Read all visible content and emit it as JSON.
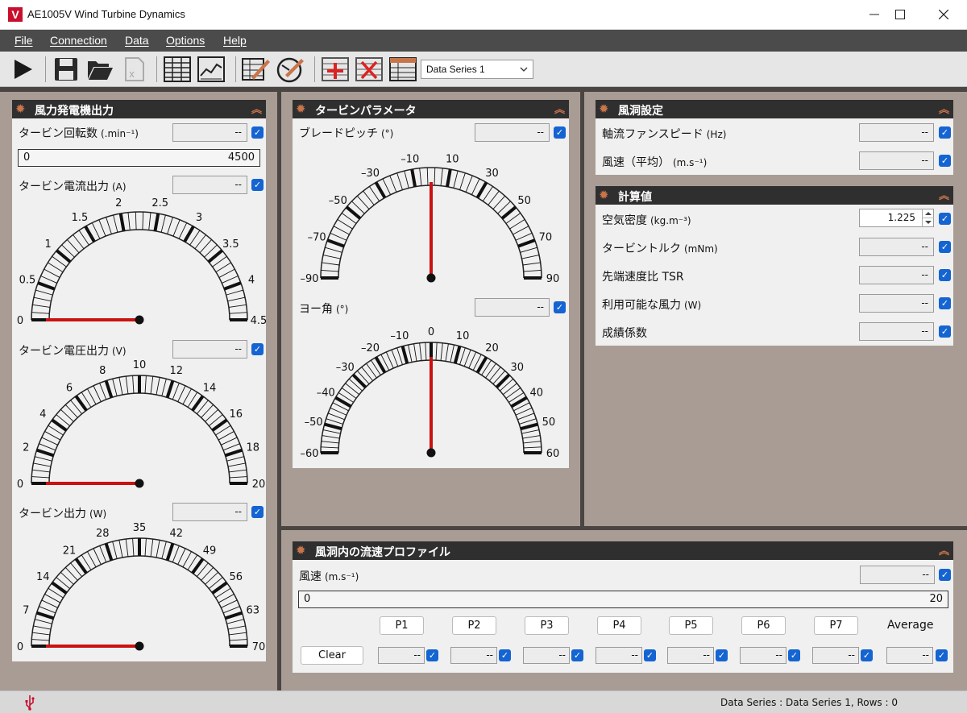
{
  "window": {
    "title": "AE1005V Wind Turbine Dynamics",
    "logo": "V"
  },
  "menu": [
    "File",
    "Connection",
    "Data",
    "Options",
    "Help"
  ],
  "toolbar": {
    "selected_series": "Data Series 1"
  },
  "generator_panel": {
    "title": "風力発電機出力",
    "speed": {
      "label": "タービン回転数",
      "unit": "(.min⁻¹)",
      "value": "--",
      "range_min": "0",
      "range_max": "4500"
    },
    "current": {
      "label": "タービン電流出力",
      "unit": "(A)",
      "value": "--",
      "needle": 0,
      "ticks": [
        "0",
        "0.5",
        "1",
        "1.5",
        "2",
        "2.5",
        "3",
        "3.5",
        "4",
        "4.5"
      ]
    },
    "voltage": {
      "label": "タービン電圧出力",
      "unit": "(V)",
      "value": "--",
      "needle": 0,
      "ticks": [
        "0",
        "2",
        "4",
        "6",
        "8",
        "10",
        "12",
        "14",
        "16",
        "18",
        "20"
      ]
    },
    "power": {
      "label": "タービン出力",
      "unit": "(W)",
      "value": "--",
      "needle": 0,
      "ticks": [
        "0",
        "7",
        "14",
        "21",
        "28",
        "35",
        "42",
        "49",
        "56",
        "63",
        "70"
      ]
    }
  },
  "turbine_panel": {
    "title": "タービンパラメータ",
    "pitch": {
      "label": "ブレードピッチ",
      "unit": "(°)",
      "value": "--",
      "needle": 0,
      "ticks": [
        "–90",
        "–70",
        "–50",
        "–30",
        "–10",
        "10",
        "30",
        "50",
        "70",
        "90"
      ]
    },
    "yaw": {
      "label": "ヨー角",
      "unit": "(°)",
      "value": "--",
      "needle": 0,
      "ticks": [
        "–60",
        "–50",
        "–40",
        "–30",
        "–20",
        "–10",
        "0",
        "10",
        "20",
        "30",
        "40",
        "50",
        "60"
      ]
    }
  },
  "tunnel_panel": {
    "title": "風洞設定",
    "fan": {
      "label": "軸流ファンスピード",
      "unit": "(Hz)",
      "value": "--"
    },
    "wind": {
      "label": "風速（平均）",
      "unit": "(m.s⁻¹)",
      "value": "--"
    }
  },
  "calc_panel": {
    "title": "計算値",
    "air_density": {
      "label": "空気密度",
      "unit": "(kg.m⁻³)",
      "value": "1.225"
    },
    "torque": {
      "label": "タービントルク",
      "unit": "(mNm)",
      "value": "--"
    },
    "tsr": {
      "label": "先端速度比 TSR",
      "unit": "",
      "value": "--"
    },
    "avail_power": {
      "label": "利用可能な風力",
      "unit": "(W)",
      "value": "--"
    },
    "coeff": {
      "label": "成績係数",
      "unit": "",
      "value": "--"
    }
  },
  "profile_panel": {
    "title": "風洞内の流速プロファイル",
    "wind": {
      "label": "風速",
      "unit": "(m.s⁻¹)",
      "value": "--",
      "range_min": "0",
      "range_max": "20"
    },
    "points": [
      "P1",
      "P2",
      "P3",
      "P4",
      "P5",
      "P6",
      "P7"
    ],
    "point_values": [
      "--",
      "--",
      "--",
      "--",
      "--",
      "--",
      "--"
    ],
    "average_label": "Average",
    "average_value": "--",
    "clear_label": "Clear"
  },
  "status": {
    "text": "Data Series : Data Series 1,  Rows : 0"
  },
  "colors": {
    "accent": "#c9754b",
    "check": "#1464d2",
    "needle": "#cc1111",
    "header": "#2f2f2f"
  }
}
